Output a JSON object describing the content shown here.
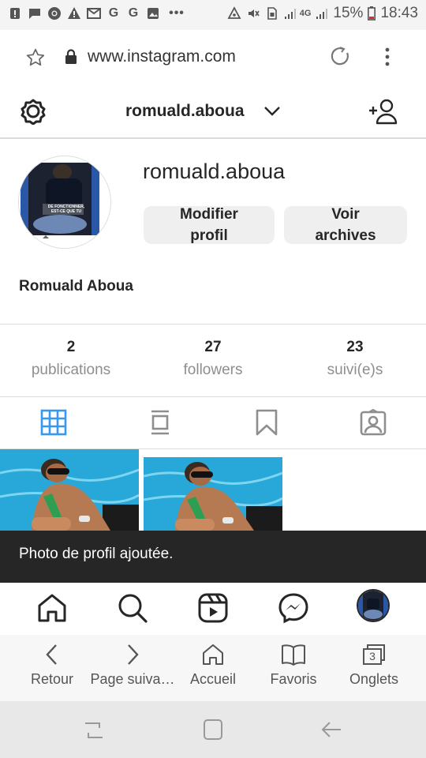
{
  "status_bar": {
    "battery": "15%",
    "time": "18:43",
    "network": "4G",
    "left_icons": [
      "notification-icon",
      "message-icon",
      "chrome-icon",
      "warning-icon",
      "gmail-icon",
      "google-icon",
      "google-icon",
      "gallery-icon",
      "more-dots-icon"
    ],
    "right_icons": [
      "hotspot-icon",
      "mute-icon",
      "sim-icon",
      "signal-icon",
      "signal-icon",
      "battery-icon"
    ]
  },
  "browser": {
    "url": "www.instagram.com"
  },
  "header": {
    "username": "romuald.aboua"
  },
  "profile": {
    "username": "romuald.aboua",
    "full_name": "Romuald Aboua",
    "edit_button": [
      "Modifier",
      "profil"
    ],
    "archive_button": [
      "Voir",
      "archives"
    ],
    "avatar_caption": "DE FONCTIONNER, EST-CE QUE TU"
  },
  "stats": [
    {
      "number": "2",
      "label": "publications"
    },
    {
      "number": "27",
      "label": "followers"
    },
    {
      "number": "23",
      "label": "suivi(e)s"
    }
  ],
  "snackbar": {
    "text": "Photo de profil ajoutée."
  },
  "browser_nav": {
    "back": "Retour",
    "forward": "Page suiva…",
    "home": "Accueil",
    "bookmarks": "Favoris",
    "tabs": "Onglets",
    "tab_count": "3"
  },
  "colors": {
    "accent": "#3897f0",
    "snackbar": "#262626",
    "pool": "#27a8d9"
  }
}
